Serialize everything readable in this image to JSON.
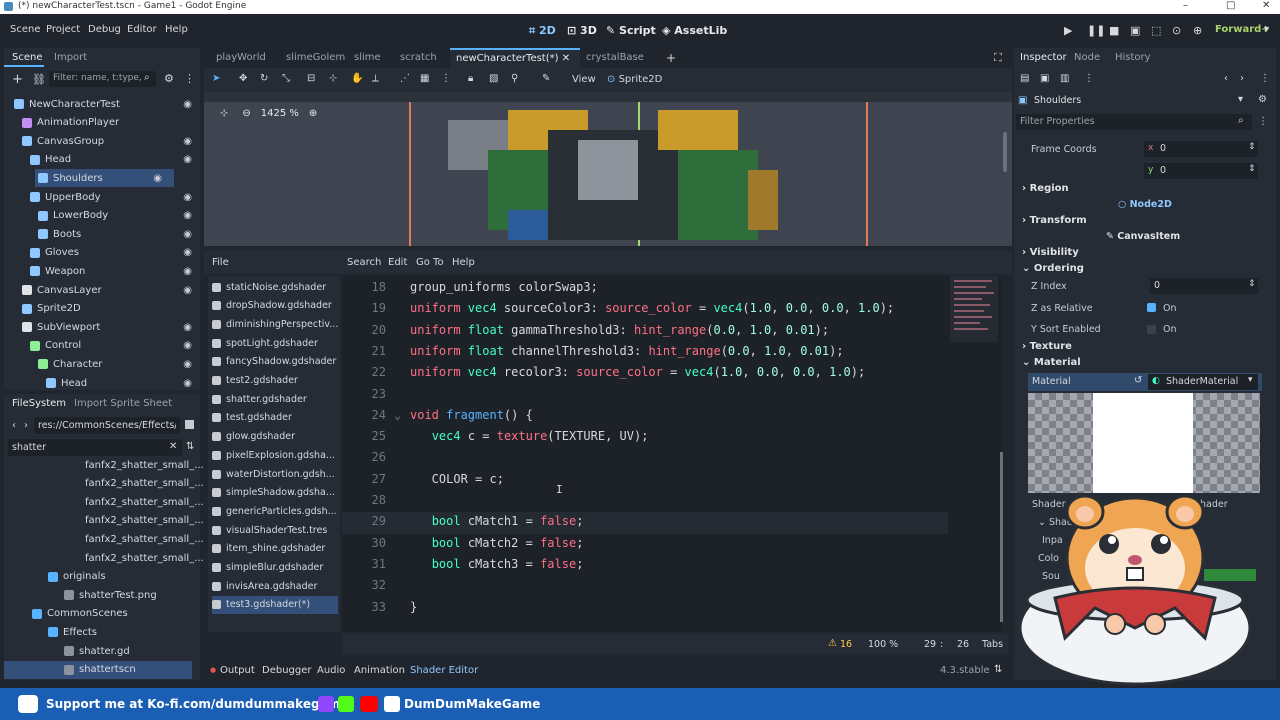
{
  "window": {
    "title": "(*) newCharacterTest.tscn - Game1 - Godot Engine",
    "minimize": "–",
    "maximize": "□",
    "close": "✕"
  },
  "menu": {
    "items": [
      "Scene",
      "Project",
      "Debug",
      "Editor",
      "Help"
    ],
    "modes": [
      "2D",
      "3D",
      "Script",
      "AssetLib"
    ],
    "renderer": "Forward+"
  },
  "scene_panel": {
    "tabs": [
      "Scene",
      "Import"
    ],
    "filter_placeholder": "Filter: name, t:type, g",
    "nodes": [
      {
        "label": "NewCharacterTest",
        "indent": 0
      },
      {
        "label": "AnimationPlayer",
        "indent": 1
      },
      {
        "label": "CanvasGroup",
        "indent": 1
      },
      {
        "label": "Head",
        "indent": 2
      },
      {
        "label": "Shoulders",
        "indent": 2
      },
      {
        "label": "UpperBody",
        "indent": 2
      },
      {
        "label": "LowerBody",
        "indent": 3
      },
      {
        "label": "Boots",
        "indent": 3
      },
      {
        "label": "Gloves",
        "indent": 2
      },
      {
        "label": "Weapon",
        "indent": 2
      },
      {
        "label": "CanvasLayer",
        "indent": 1
      },
      {
        "label": "Sprite2D",
        "indent": 1
      },
      {
        "label": "SubViewport",
        "indent": 1
      },
      {
        "label": "Control",
        "indent": 2
      },
      {
        "label": "Character",
        "indent": 3
      },
      {
        "label": "Head",
        "indent": 4
      }
    ]
  },
  "filesystem": {
    "tabs": [
      "FileSystem",
      "Import Sprite Sheet"
    ],
    "path": "res://CommonScenes/Effects/s",
    "search": "shatter",
    "items": [
      {
        "label": "fanfx2_shatter_small_...",
        "indent": 4
      },
      {
        "label": "fanfx2_shatter_small_...",
        "indent": 4
      },
      {
        "label": "fanfx2_shatter_small_...",
        "indent": 4
      },
      {
        "label": "fanfx2_shatter_small_...",
        "indent": 4
      },
      {
        "label": "fanfx2_shatter_small_...",
        "indent": 4
      },
      {
        "label": "fanfx2_shatter_small_...",
        "indent": 4
      },
      {
        "label": "originals",
        "indent": 2
      },
      {
        "label": "shatterTest.png",
        "indent": 3
      },
      {
        "label": "CommonScenes",
        "indent": 1
      },
      {
        "label": "Effects",
        "indent": 2
      },
      {
        "label": "shatter.gd",
        "indent": 3
      },
      {
        "label": "shattertscn",
        "indent": 3
      }
    ]
  },
  "editor_tabs": [
    "playWorld",
    "slimeGolem",
    "slime",
    "scratch",
    "newCharacterTest(*)",
    "crystalBase"
  ],
  "viewport_toolbar": {
    "view": "View",
    "sprite": "Sprite2D",
    "zoom": "1425 %"
  },
  "shader_editor": {
    "menu": [
      "File",
      "Search",
      "Edit",
      "Go To",
      "Help"
    ],
    "files": [
      "staticNoise.gdshader",
      "dropShadow.gdshader",
      "diminishingPerspectiv...",
      "spotLight.gdshader",
      "fancyShadow.gdshader",
      "test2.gdshader",
      "shatter.gdshader",
      "test.gdshader",
      "glow.gdshader",
      "pixelExplosion.gdsha...",
      "waterDistortion.gdsh...",
      "simpleShadow.gdsha...",
      "genericParticles.gdsh...",
      "visualShaderTest.tres",
      "item_shine.gdshader",
      "simpleBlur.gdshader",
      "invisArea.gdshader",
      "test3.gdshader(*)"
    ],
    "lines": [
      {
        "n": "18",
        "parts": [
          [
            "t",
            "group_uniforms colorSwap3;"
          ]
        ]
      },
      {
        "n": "19",
        "parts": [
          [
            "kw",
            "uniform "
          ],
          [
            "ty",
            "vec4 "
          ],
          [
            "t",
            "sourceColor3: "
          ],
          [
            "kw",
            "source_color "
          ],
          [
            "t",
            "= "
          ],
          [
            "ty",
            "vec4"
          ],
          [
            "t",
            "("
          ],
          [
            "nm",
            "1.0"
          ],
          [
            "t",
            ", "
          ],
          [
            "nm",
            "0.0"
          ],
          [
            "t",
            ", "
          ],
          [
            "nm",
            "0.0"
          ],
          [
            "t",
            ", "
          ],
          [
            "nm",
            "1.0"
          ],
          [
            "t",
            ");"
          ]
        ]
      },
      {
        "n": "20",
        "parts": [
          [
            "kw",
            "uniform "
          ],
          [
            "ty",
            "float "
          ],
          [
            "t",
            "gammaThreshold3: "
          ],
          [
            "kw",
            "hint_range"
          ],
          [
            "t",
            "("
          ],
          [
            "nm",
            "0.0"
          ],
          [
            "t",
            ", "
          ],
          [
            "nm",
            "1.0"
          ],
          [
            "t",
            ", "
          ],
          [
            "nm",
            "0.01"
          ],
          [
            "t",
            ");"
          ]
        ]
      },
      {
        "n": "21",
        "parts": [
          [
            "kw",
            "uniform "
          ],
          [
            "ty",
            "float "
          ],
          [
            "t",
            "channelThreshold3: "
          ],
          [
            "kw",
            "hint_range"
          ],
          [
            "t",
            "("
          ],
          [
            "nm",
            "0.0"
          ],
          [
            "t",
            ", "
          ],
          [
            "nm",
            "1.0"
          ],
          [
            "t",
            ", "
          ],
          [
            "nm",
            "0.01"
          ],
          [
            "t",
            ");"
          ]
        ]
      },
      {
        "n": "22",
        "parts": [
          [
            "kw",
            "uniform "
          ],
          [
            "ty",
            "vec4 "
          ],
          [
            "t",
            "recolor3: "
          ],
          [
            "kw",
            "source_color "
          ],
          [
            "t",
            "= "
          ],
          [
            "ty",
            "vec4"
          ],
          [
            "t",
            "("
          ],
          [
            "nm",
            "1.0"
          ],
          [
            "t",
            ", "
          ],
          [
            "nm",
            "0.0"
          ],
          [
            "t",
            ", "
          ],
          [
            "nm",
            "0.0"
          ],
          [
            "t",
            ", "
          ],
          [
            "nm",
            "1.0"
          ],
          [
            "t",
            ");"
          ]
        ]
      },
      {
        "n": "23",
        "parts": []
      },
      {
        "n": "24",
        "parts": [
          [
            "kw",
            "void "
          ],
          [
            "fn",
            "fragment"
          ],
          [
            "t",
            "() {"
          ]
        ]
      },
      {
        "n": "25",
        "parts": [
          [
            "t",
            "   "
          ],
          [
            "ty",
            "vec4 "
          ],
          [
            "t",
            "c = "
          ],
          [
            "kw",
            "texture"
          ],
          [
            "t",
            "(TEXTURE, UV);"
          ]
        ]
      },
      {
        "n": "26",
        "parts": []
      },
      {
        "n": "27",
        "parts": [
          [
            "t",
            "   COLOR = c;"
          ]
        ]
      },
      {
        "n": "28",
        "parts": []
      },
      {
        "n": "29",
        "parts": [
          [
            "t",
            "   "
          ],
          [
            "ty",
            "bool "
          ],
          [
            "t",
            "cMatch1 = "
          ],
          [
            "kw",
            "false"
          ],
          [
            "t",
            ";"
          ]
        ]
      },
      {
        "n": "30",
        "parts": [
          [
            "t",
            "   "
          ],
          [
            "ty",
            "bool "
          ],
          [
            "t",
            "cMatch2 = "
          ],
          [
            "kw",
            "false"
          ],
          [
            "t",
            ";"
          ]
        ]
      },
      {
        "n": "31",
        "parts": [
          [
            "t",
            "   "
          ],
          [
            "ty",
            "bool "
          ],
          [
            "t",
            "cMatch3 = "
          ],
          [
            "kw",
            "false"
          ],
          [
            "t",
            ";"
          ]
        ]
      },
      {
        "n": "32",
        "parts": []
      },
      {
        "n": "33",
        "parts": [
          [
            "t",
            "}"
          ]
        ]
      }
    ],
    "status": {
      "warnings": "16",
      "zoom": "100 %",
      "line": "29",
      "col": "26",
      "indent": "Tabs"
    }
  },
  "bottom_tabs": [
    "Output",
    "Debugger",
    "Audio",
    "Animation",
    "Shader Editor"
  ],
  "version": "4.3.stable",
  "inspector": {
    "tabs": [
      "Inspector",
      "Node",
      "History"
    ],
    "node": "Shoulders",
    "filter_placeholder": "Filter Properties",
    "frame_coords": "Frame Coords",
    "x_label": "x",
    "x_value": "0",
    "y_label": "y",
    "y_value": "0",
    "sections": [
      "Region",
      "Transform",
      "Visibility",
      "Ordering",
      "Texture",
      "Material"
    ],
    "node2d": "Node2D",
    "canvasitem": "CanvasItem",
    "z_index_label": "Z Index",
    "z_index_value": "0",
    "z_relative_label": "Z as Relative",
    "z_relative_value": "On",
    "y_sort_label": "Y Sort Enabled",
    "y_sort_value": "On",
    "material_label": "Material",
    "material_value": "ShaderMaterial",
    "shader_label": "Shader",
    "shader_value": "Shader",
    "inpa": "Inpa",
    "colo": "Colo",
    "sou": "Sou"
  },
  "support_bar": {
    "text": "Support me at Ko-fi.com/dumdummakegame",
    "channel": "DumDumMakeGame"
  }
}
